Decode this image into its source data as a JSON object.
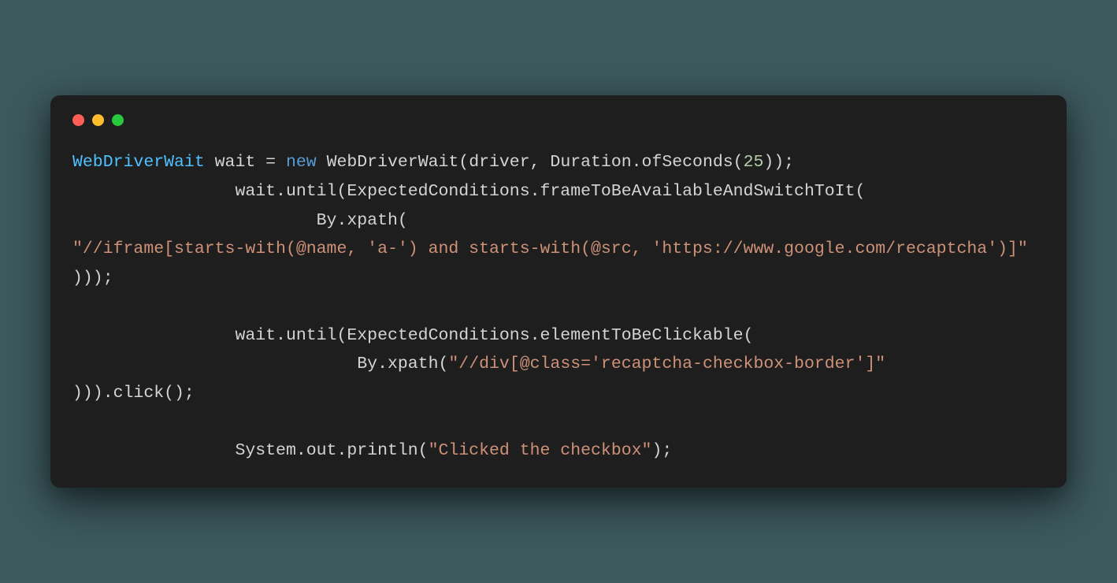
{
  "window": {
    "controls": {
      "red": "close",
      "yellow": "minimize",
      "green": "maximize"
    }
  },
  "code": {
    "tokens": {
      "type_WebDriverWait": "WebDriverWait",
      "var_wait": " wait = ",
      "kw_new": "new",
      "call_WebDriverWait": " WebDriverWait(driver, Duration.ofSeconds(",
      "num_25": "25",
      "close_call1": "));",
      "line2": "                wait.until(ExpectedConditions.frameToBeAvailableAndSwitchToIt(",
      "line3": "                        By.xpath(",
      "str_xpath1": "\"//iframe[starts-with(@name, 'a-') and starts-with(@src, 'https://www.google.com/recaptcha')]\"",
      "line5": ")));",
      "line7": "                wait.until(ExpectedConditions.elementToBeClickable(",
      "line8a": "                            By.xpath(",
      "str_xpath2": "\"//div[@class='recaptcha-checkbox-border']\"",
      "line9": "))).click();",
      "line11a": "                System.out.println(",
      "str_clicked": "\"Clicked the checkbox\"",
      "line11b": ");"
    }
  }
}
